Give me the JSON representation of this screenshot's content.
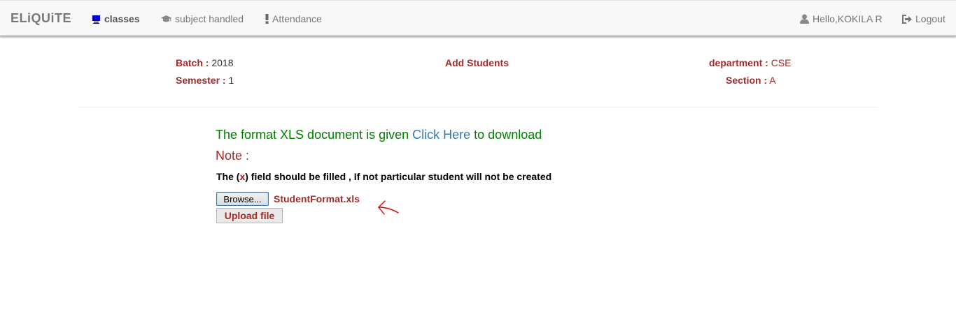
{
  "navbar": {
    "brand": "ELiQUiTE",
    "items": [
      {
        "label": "classes",
        "icon": "desktop-icon",
        "active": true
      },
      {
        "label": "subject handled",
        "icon": "graduation-cap-icon"
      },
      {
        "label": "Attendance",
        "icon": "exclamation-icon"
      }
    ],
    "user_greeting": "Hello,KOKILA R",
    "logout_label": "Logout"
  },
  "header": {
    "batch_label": "Batch :",
    "batch_value": "2018",
    "semester_label": "Semester :",
    "semester_value": "1",
    "title": "Add Students",
    "department_label": "department :",
    "department_value": "CSE",
    "section_label": "Section :",
    "section_value": "A"
  },
  "content": {
    "format_prefix": "The format XLS document is given ",
    "format_link": "Click Here",
    "format_suffix": " to download",
    "note_label": "Note :",
    "rule_prefix": "The (",
    "rule_mark": "x",
    "rule_suffix": ") field should be filled , If not particular student will not be created",
    "browse_label": "Browse...",
    "selected_file": "StudentFormat.xls",
    "upload_label": "Upload file"
  },
  "colors": {
    "accent_red": "#a52a2a",
    "green": "#008000",
    "link_blue": "#337ab7",
    "annotation_red": "#e00000"
  }
}
